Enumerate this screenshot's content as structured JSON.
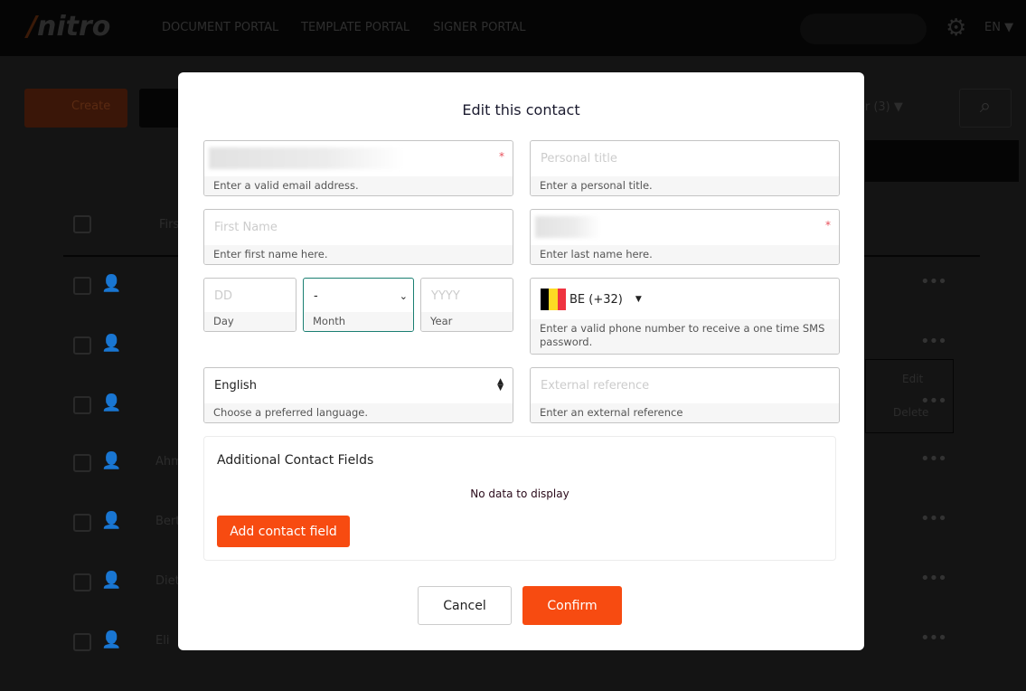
{
  "background": {
    "logo": "nitro",
    "nav": [
      "DOCUMENT PORTAL",
      "TEMPLATE PORTAL",
      "SIGNER PORTAL"
    ],
    "language": "EN ▼",
    "create_label": "Create",
    "filter_label": "Filter (3) ▼",
    "column_first": "First",
    "rows": [
      "",
      "",
      "",
      "Ahm",
      "Bert",
      "Diet",
      "Eli"
    ],
    "menu": {
      "edit": "Edit",
      "delete": "Delete"
    }
  },
  "modal": {
    "title": "Edit this contact",
    "email": {
      "help": "Enter a valid email address.",
      "required": "*"
    },
    "personal_title": {
      "placeholder": "Personal title",
      "help": "Enter a personal title."
    },
    "first_name": {
      "placeholder": "First Name",
      "help": "Enter first name here."
    },
    "last_name": {
      "help": "Enter last name here.",
      "required": "*"
    },
    "day": {
      "placeholder": "DD",
      "help": "Day"
    },
    "month": {
      "value": "-",
      "help": "Month"
    },
    "year": {
      "placeholder": "YYYY",
      "help": "Year"
    },
    "phone": {
      "country": "BE (+32)",
      "help": "Enter a valid phone number to receive a one time SMS password."
    },
    "language": {
      "value": "English",
      "help": "Choose a preferred language."
    },
    "external_reference": {
      "placeholder": "External reference",
      "help": "Enter an external reference"
    },
    "additional": {
      "title": "Additional Contact Fields",
      "empty": "No data to display",
      "add_label": "Add contact field"
    },
    "cancel_label": "Cancel",
    "confirm_label": "Confirm"
  },
  "colors": {
    "accent": "#f74b11",
    "focus": "#1a7f72"
  }
}
